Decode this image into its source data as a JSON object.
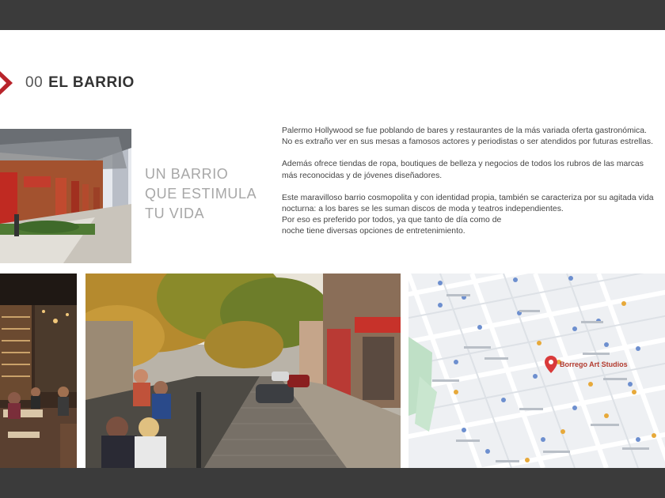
{
  "section": {
    "number": "00",
    "title": "EL BARRIO"
  },
  "tagline": [
    "UN BARRIO",
    "QUE ESTIMULA",
    "TU VIDA"
  ],
  "paragraphs": [
    [
      "Palermo Hollywood se fue poblando de bares y restaurantes de la más variada oferta gastronómica.",
      "No es extraño ver en sus mesas a famosos actores y periodistas o ser atendidos por futuras estrellas."
    ],
    [
      "Además ofrece tiendas de ropa, boutiques de belleza y negocios de todos los rubros de las marcas",
      "más reconocidas y de jóvenes diseñadores."
    ],
    [
      "Este maravilloso barrio cosmopolita y con identidad propia, también se caracteriza por su agitada vida",
      "nocturna: a los bares se les suman discos de moda y teatros independientes.",
      "Por eso es preferido por todos, ya que tanto de día como de",
      "noche tiene diversas opciones de entretenimiento."
    ]
  ],
  "map": {
    "marker_label": "Borrego Art Studios",
    "accent": "#d93a3a"
  },
  "colors": {
    "accent": "#b8242b",
    "frame": "#3b3b3b"
  }
}
